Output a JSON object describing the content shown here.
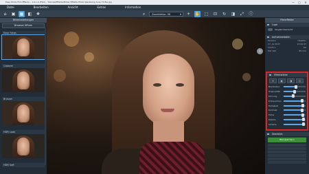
{
  "window": {
    "title": "Easy Photo Film Effects – 1.0.1.4 (FSO) – Tutorial/Effekte/Bilder Effekte Photo Rendering Sure 70 file.jpg",
    "controls": [
      "—",
      "▢",
      "✕"
    ]
  },
  "menu": [
    "Datei",
    "Bearbeiten",
    "Ansicht",
    "Extras",
    "Information"
  ],
  "toolbar": {
    "zoom_value": "Zoomfaktor: 96"
  },
  "left_panel": {
    "title": "Bildeinstellungen",
    "open_button": "Browser öffnen",
    "effects": [
      "Easy Fotos",
      "Cabaret",
      "Brüssel",
      "HDR Look",
      "HDR Soft"
    ]
  },
  "right_panel": {
    "title": "Filmeffekte",
    "loupe_section": "Lupe",
    "loupe_toggle": "Vergleichsansicht",
    "info_section": "Aufnahmedaten",
    "info_rows": [
      {
        "left": "Kamera",
        "right": "Objektiv"
      },
      {
        "left": "17. Jul 2017",
        "right": "13:02:47"
      },
      {
        "left": "1/125 s",
        "right": "f/2"
      },
      {
        "left": "ISO 100",
        "right": "85 mm"
      }
    ],
    "effect_section": "Effektstärke",
    "sliders": [
      {
        "label": "Bearbeiten",
        "value": 0.55
      },
      {
        "label": "Originalität",
        "value": 0.5
      },
      {
        "label": "Körnung",
        "value": 0.45
      },
      {
        "label": "Entrauschen",
        "value": 0.85
      },
      {
        "label": "Helligkeit",
        "value": 0.88
      },
      {
        "label": "Kontrast",
        "value": 0.85
      },
      {
        "label": "Farbe",
        "value": 0.88
      },
      {
        "label": "Details",
        "value": 0.9
      },
      {
        "label": "Schärfe",
        "value": 0.9
      }
    ],
    "export_section": "Überblick",
    "export_button": "Bild speichern"
  },
  "colors": {
    "accent": "#5aa8ea",
    "highlight": "#e02424",
    "export": "#3d8f3a"
  }
}
